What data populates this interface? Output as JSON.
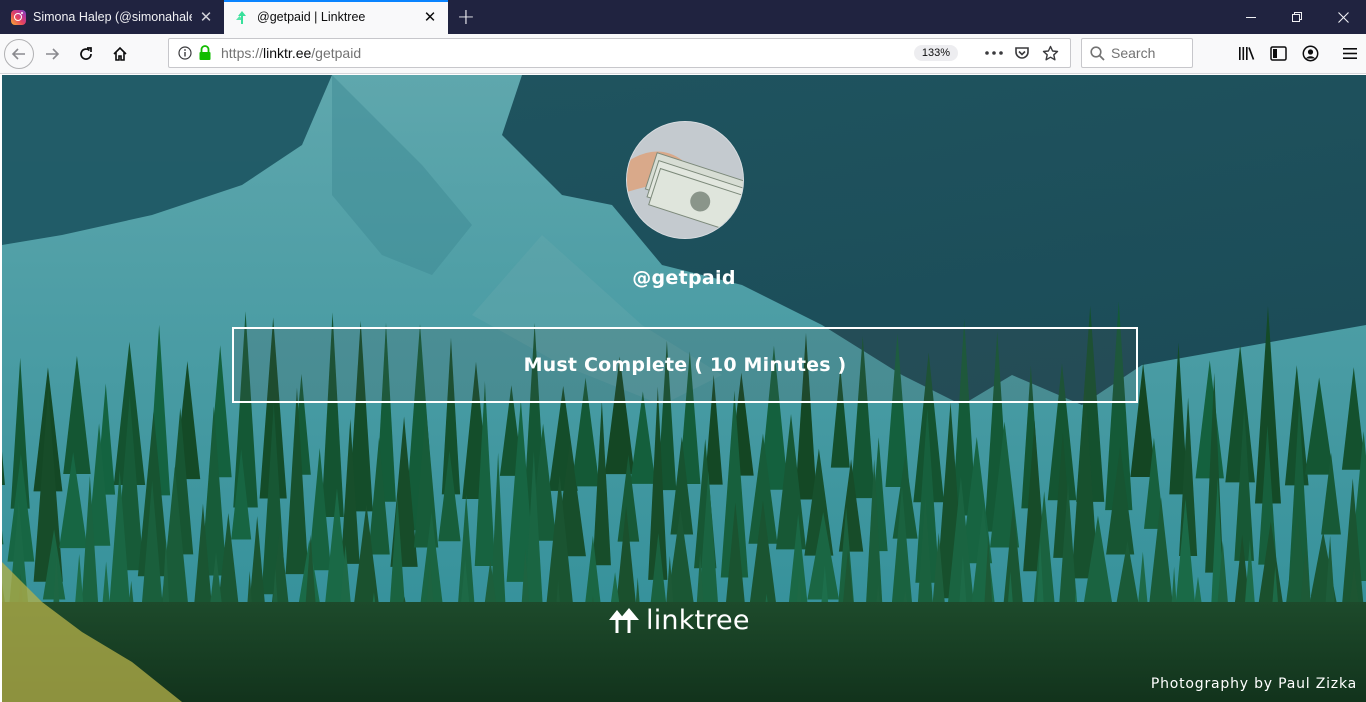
{
  "browser": {
    "tabs": [
      {
        "title": "Simona Halep (@simonahalep)",
        "favicon": "instagram-icon",
        "active": false
      },
      {
        "title": "@getpaid | Linktree",
        "favicon": "linktree-icon",
        "active": true
      }
    ],
    "new_tab_label": "+",
    "url": {
      "prefix": "https://",
      "host": "linktr.ee",
      "path": "/getpaid"
    },
    "zoom": "133%",
    "search_placeholder": "Search"
  },
  "page": {
    "username": "@getpaid",
    "links": [
      {
        "label": "Must Complete ( 10 Minutes )"
      }
    ],
    "brand": "linktree",
    "credit": "Photography by Paul Zizka"
  },
  "colors": {
    "tabstrip": "#202340",
    "tab_accent": "#0a84ff",
    "lock_green": "#12bc00",
    "linktree_green": "#39e09b"
  }
}
